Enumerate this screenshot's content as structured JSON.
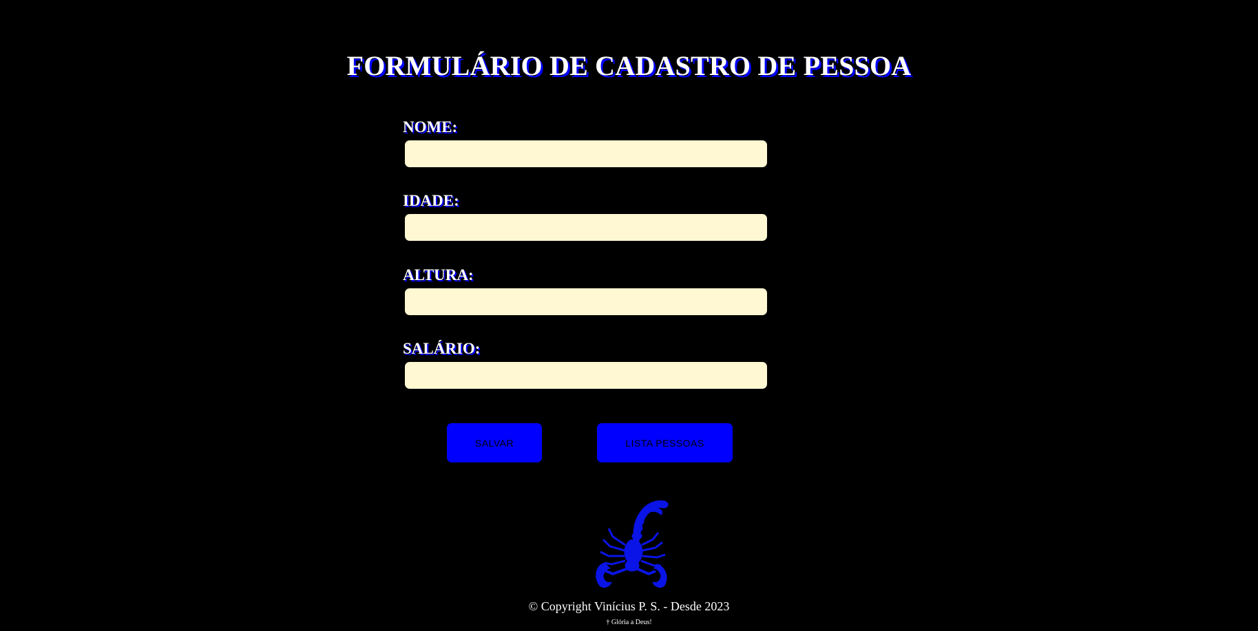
{
  "page": {
    "title": "FORMULÁRIO DE CADASTRO DE PESSOA"
  },
  "form": {
    "fields": [
      {
        "label": "NOME:",
        "value": "",
        "placeholder": ""
      },
      {
        "label": "IDADE:",
        "value": "",
        "placeholder": ""
      },
      {
        "label": "ALTURA:",
        "value": "",
        "placeholder": ""
      },
      {
        "label": "SALÁRIO:",
        "value": "",
        "placeholder": ""
      }
    ],
    "save_label": "SALVAR",
    "list_label": "LISTA PESSOAS"
  },
  "footer": {
    "logo_icon": "scorpion-icon",
    "copyright": "© Copyright Vinícius P. S. - Desde 2023",
    "blessing": "† Glória a Deus!"
  },
  "colors": {
    "background": "#000000",
    "accent": "#0000ff",
    "input_background": "#fff8d2",
    "text": "#ffffff"
  }
}
